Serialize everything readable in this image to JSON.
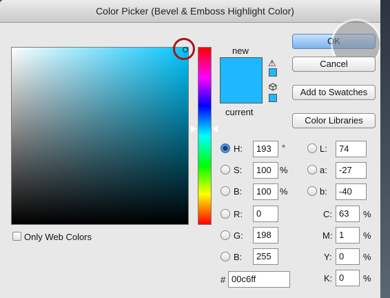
{
  "window": {
    "title": "Color Picker (Bevel & Emboss Highlight Color)"
  },
  "labels": {
    "new": "new",
    "current": "current",
    "only_web_colors": "Only Web Colors"
  },
  "buttons": {
    "ok": "OK",
    "cancel": "Cancel",
    "add_to_swatches": "Add to Swatches",
    "color_libraries": "Color Libraries"
  },
  "hsb": {
    "h": {
      "label": "H:",
      "value": "193",
      "unit": "°",
      "selected": true
    },
    "s": {
      "label": "S:",
      "value": "100",
      "unit": "%"
    },
    "b": {
      "label": "B:",
      "value": "100",
      "unit": "%"
    }
  },
  "rgb": {
    "r": {
      "label": "R:",
      "value": "0"
    },
    "g": {
      "label": "G:",
      "value": "198"
    },
    "b": {
      "label": "B:",
      "value": "255"
    }
  },
  "lab": {
    "l": {
      "label": "L:",
      "value": "74"
    },
    "a": {
      "label": "a:",
      "value": "-27"
    },
    "b": {
      "label": "b:",
      "value": "-40"
    }
  },
  "cmyk": {
    "c": {
      "label": "C:",
      "value": "63",
      "unit": "%"
    },
    "m": {
      "label": "M:",
      "value": "1",
      "unit": "%"
    },
    "y": {
      "label": "Y:",
      "value": "0",
      "unit": "%"
    },
    "k": {
      "label": "K:",
      "value": "0",
      "unit": "%"
    }
  },
  "hex": {
    "label": "#",
    "value": "00c6ff"
  },
  "colors": {
    "selected": "#1db8ff",
    "hue_pure": "#00c6ff"
  },
  "icons": {
    "gamut_warning": "warning-triangle-icon",
    "web_safe": "cube-icon"
  },
  "options": {
    "only_web_colors": false
  }
}
